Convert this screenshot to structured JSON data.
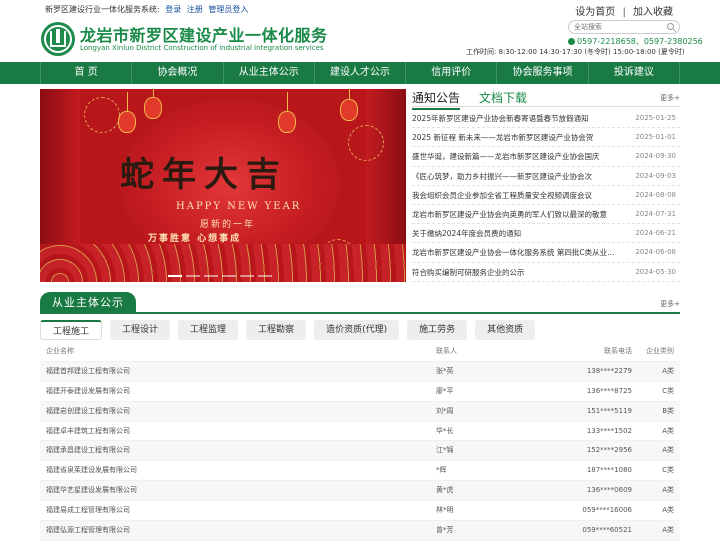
{
  "topbar": {
    "system_label": "新罗区建设行业一体化服务系统:",
    "login": "登录",
    "register": "注册",
    "admin_login": "管理员登入",
    "set_home": "设为首页",
    "divider": "|",
    "add_favorite": "加入收藏"
  },
  "header": {
    "title": "龙岩市新罗区建设产业一体化服务",
    "subtitle": "Longyan Xinluo District Construction of industrial integration services",
    "search_placeholder": "全站搜索",
    "phones": "0597-2218658、0597-2380256",
    "hours": "工作时间: 8:30-12:00 14:30-17:30 (冬令时) 15:00-18:00 (夏令时)"
  },
  "nav": {
    "items": [
      "首 页",
      "协会概况",
      "从业主体公示",
      "建设人才公示",
      "信用评价",
      "协会服务事项",
      "投诉建议"
    ]
  },
  "banner": {
    "headline": "蛇年大吉",
    "english": "HAPPY NEW YEAR",
    "wish1": "愿新的一年",
    "wish2": "万事胜意  心想事成"
  },
  "notice": {
    "tab_active": "通知公告",
    "tab_other": "文档下载",
    "more": "更多+",
    "items": [
      {
        "title": "2025年新罗区建设产业协会新春寄语暨春节放假通知",
        "date": "2025-01-25"
      },
      {
        "title": "2025 新征程 新未来——龙岩市新罗区建设产业协会贺",
        "date": "2025-01-01"
      },
      {
        "title": "盛世华诞，建设新篇——龙岩市新罗区建设产业协会国庆",
        "date": "2024-09-30"
      },
      {
        "title": "《匠心筑梦，助力乡村振兴——新罗区建设产业协会次",
        "date": "2024-09-03"
      },
      {
        "title": "我会组织会员企业参加全省工程质量安全视频调度会议",
        "date": "2024-08-08"
      },
      {
        "title": "龙岩市新罗区建设产业协会向英勇的军人们致以最深的敬意",
        "date": "2024-07-31"
      },
      {
        "title": "关于缴纳2024年度会员费的通知",
        "date": "2024-06-21"
      },
      {
        "title": "龙岩市新罗区建设产业协会一体化服务系统 第四批C类从业主体",
        "date": "2024-06-08"
      },
      {
        "title": "符合购买编制可研服务企业的公示",
        "date": "2024-05-30"
      }
    ]
  },
  "section": {
    "title": "从业主体公示",
    "more": "更多+",
    "categories": [
      "工程施工",
      "工程设计",
      "工程监理",
      "工程勘察",
      "造价资质(代理)",
      "施工劳务",
      "其他资质"
    ],
    "columns": [
      "企业名称",
      "联系人",
      "联系电话",
      "企业类别"
    ],
    "rows": [
      [
        "福建首邦建设工程有限公司",
        "张*英",
        "138****2279",
        "A类"
      ],
      [
        "福建开泰建设发展有限公司",
        "廖*平",
        "136****8725",
        "C类"
      ],
      [
        "福建岩创建设工程有限公司",
        "刘*周",
        "151****5119",
        "B类"
      ],
      [
        "福建卓丰建筑工程有限公司",
        "华*长",
        "133****1502",
        "A类"
      ],
      [
        "福建承昌建设工程有限公司",
        "江*锦",
        "152****2956",
        "A类"
      ],
      [
        "福建省泉茱建设发展有限公司",
        "*辉",
        "187****1080",
        "C类"
      ],
      [
        "福建华艺星建设发展有限公司",
        "黄*虎",
        "136****0609",
        "A类"
      ],
      [
        "福建易成工程管理有限公司",
        "林*明",
        "059****16006",
        "A类"
      ],
      [
        "福建弘源工程管理有限公司",
        "曾*芳",
        "059****60521",
        "A类"
      ]
    ]
  },
  "colors": {
    "brand_green": "#1a7a44",
    "banner_red": "#b8161a"
  }
}
